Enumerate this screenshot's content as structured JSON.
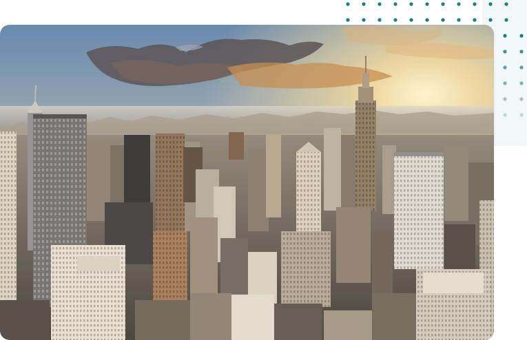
{
  "image": {
    "subject": "city-skyline-photo",
    "alt": ""
  },
  "decoration": {
    "dot_color": "#1f7d7a",
    "panel_color": "#f1f6f7"
  },
  "colors": {
    "sky_top": "#6f8fb3",
    "sky_mid": "#e9c38d",
    "sun": "#fff4c8",
    "buildings_dark": "#3c4048",
    "buildings_mid": "#7b7772",
    "buildings_light": "#c9c2b8"
  }
}
